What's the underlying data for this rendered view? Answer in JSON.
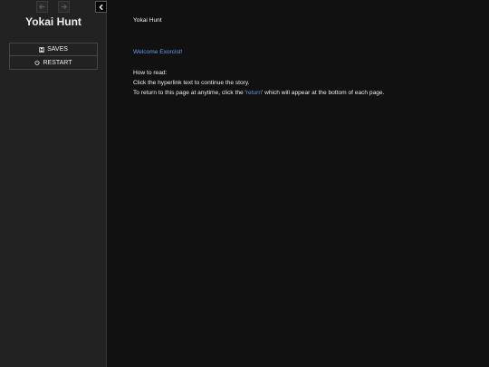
{
  "sidebar": {
    "story_title": "Yokai Hunt",
    "history_back_icon": "arrow-left-icon",
    "history_forward_icon": "arrow-right-icon",
    "toggle_icon": "chevron-left-icon",
    "menu": [
      {
        "label": "SAVES",
        "icon": "floppy-disk-icon"
      },
      {
        "label": "RESTART",
        "icon": "power-icon"
      }
    ]
  },
  "passage": {
    "heading": "Yokai Hunt",
    "welcome_link": "Welcome Exorcist!",
    "how_to_read": "How to read:",
    "instruction_1": "Click the hyperlink text to continue the story.",
    "instruction_2_before": "To return to this page at anytime, click the '",
    "instruction_2_link": "return",
    "instruction_2_after": "' which will appear at the bottom of each page."
  },
  "colors": {
    "background": "#111111",
    "sidebar": "#222222",
    "link": "#6699ee",
    "text": "#eeeeee"
  }
}
